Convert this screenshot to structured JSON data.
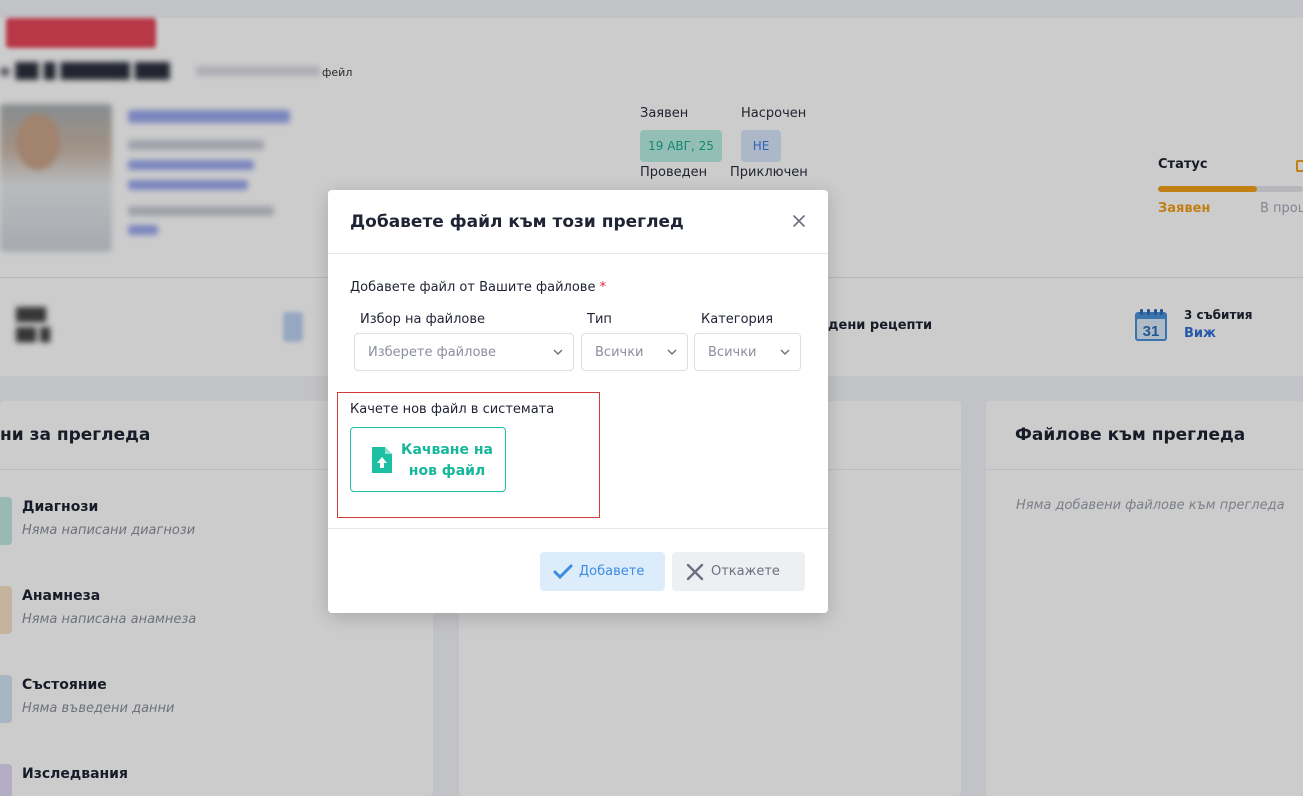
{
  "header": {
    "subtitle_suffix": "фейл"
  },
  "appointment": {
    "requested_label": "Заявен",
    "requested_value": "19 АВГ, 25",
    "scheduled_label": "Насрочен",
    "scheduled_value": "НЕ",
    "held_label": "Проведен",
    "finished_label": "Приключен"
  },
  "status": {
    "label": "Статус",
    "current_step": "Заявен",
    "next_step": "В проц",
    "progress_fraction": 0.68,
    "accent_color": "#f0a01a"
  },
  "stats": {
    "prescriptions_label": "дени рецепти",
    "calendar_day": "31",
    "events_count": "3 събития",
    "events_link": "Виж"
  },
  "left_panel": {
    "title": "ни за прегледа",
    "items": [
      {
        "title": "Диагнози",
        "subtitle": "Няма написани диагнози",
        "color": "#bfe9e0"
      },
      {
        "title": "Анамнеза",
        "subtitle": "Няма написана анамнеза",
        "color": "#f6e2c6"
      },
      {
        "title": "Състояние",
        "subtitle": "Няма въведени данни",
        "color": "#d3e4f5"
      },
      {
        "title": "Изследвания",
        "subtitle": "",
        "color": "#e2d8f3"
      }
    ]
  },
  "files_panel": {
    "title": "Файлове към прегледа",
    "empty_text": "Няма добавени файлове към прегледа"
  },
  "modal": {
    "title": "Добавете файл към този преглед",
    "close_icon": "close-icon",
    "section_label": "Добавете файл от Вашите файлове",
    "required_mark": "*",
    "file_select": {
      "label": "Избор на файлове",
      "placeholder": "Изберете файлове"
    },
    "type_select": {
      "label": "Тип",
      "value": "Всички"
    },
    "category_select": {
      "label": "Категория",
      "value": "Всички"
    },
    "upload_section_label": "Качете нов файл в системата",
    "upload_button_label": "Качване на нов файл",
    "add_button_label": "Добавете",
    "cancel_button_label": "Откажете",
    "accent_color": "#1ec0a4"
  }
}
